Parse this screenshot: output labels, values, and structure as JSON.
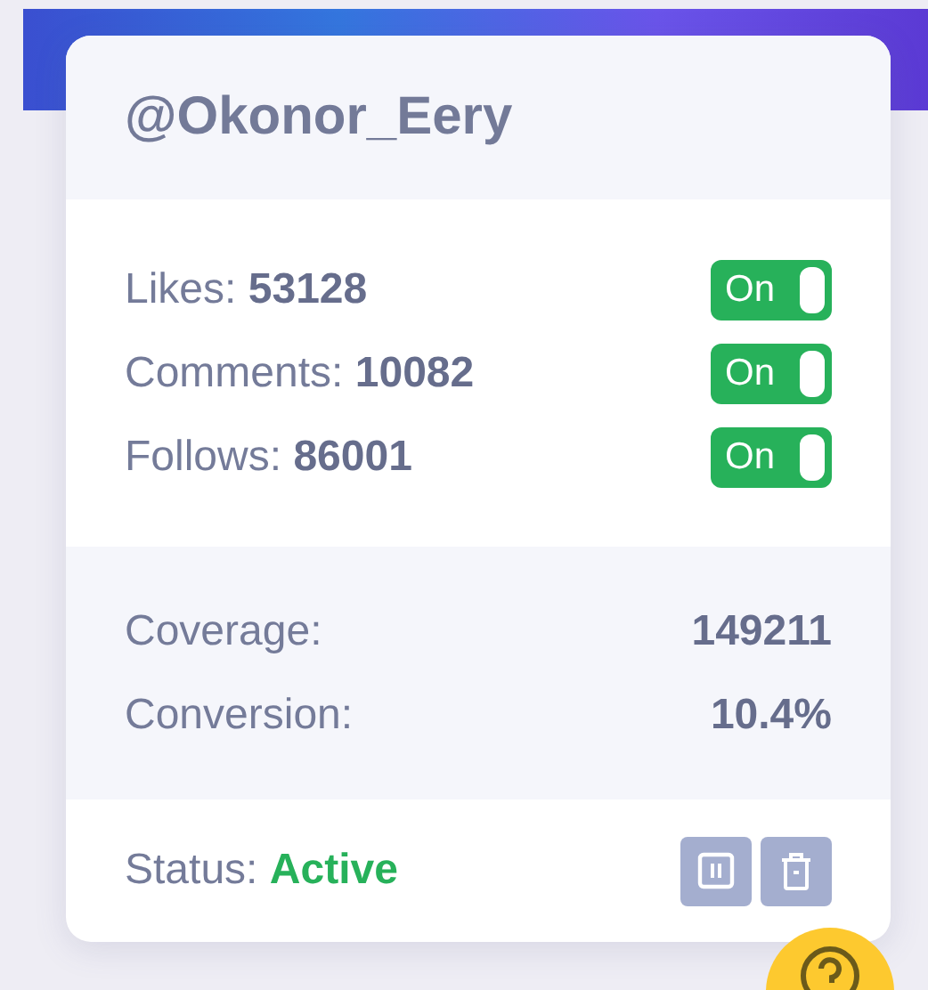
{
  "username": "@Okonor_Eery",
  "metrics": [
    {
      "label": "Likes:",
      "value": "53128",
      "toggle_label": "On",
      "on": true
    },
    {
      "label": "Comments:",
      "value": "10082",
      "toggle_label": "On",
      "on": true
    },
    {
      "label": "Follows:",
      "value": "86001",
      "toggle_label": "On",
      "on": true
    }
  ],
  "summary": [
    {
      "label": "Coverage:",
      "value": "149211"
    },
    {
      "label": "Conversion:",
      "value": "10.4%"
    }
  ],
  "status": {
    "label": "Status:",
    "value": "Active",
    "active": true
  },
  "actions": [
    {
      "kind": "pause"
    },
    {
      "kind": "delete"
    }
  ]
}
